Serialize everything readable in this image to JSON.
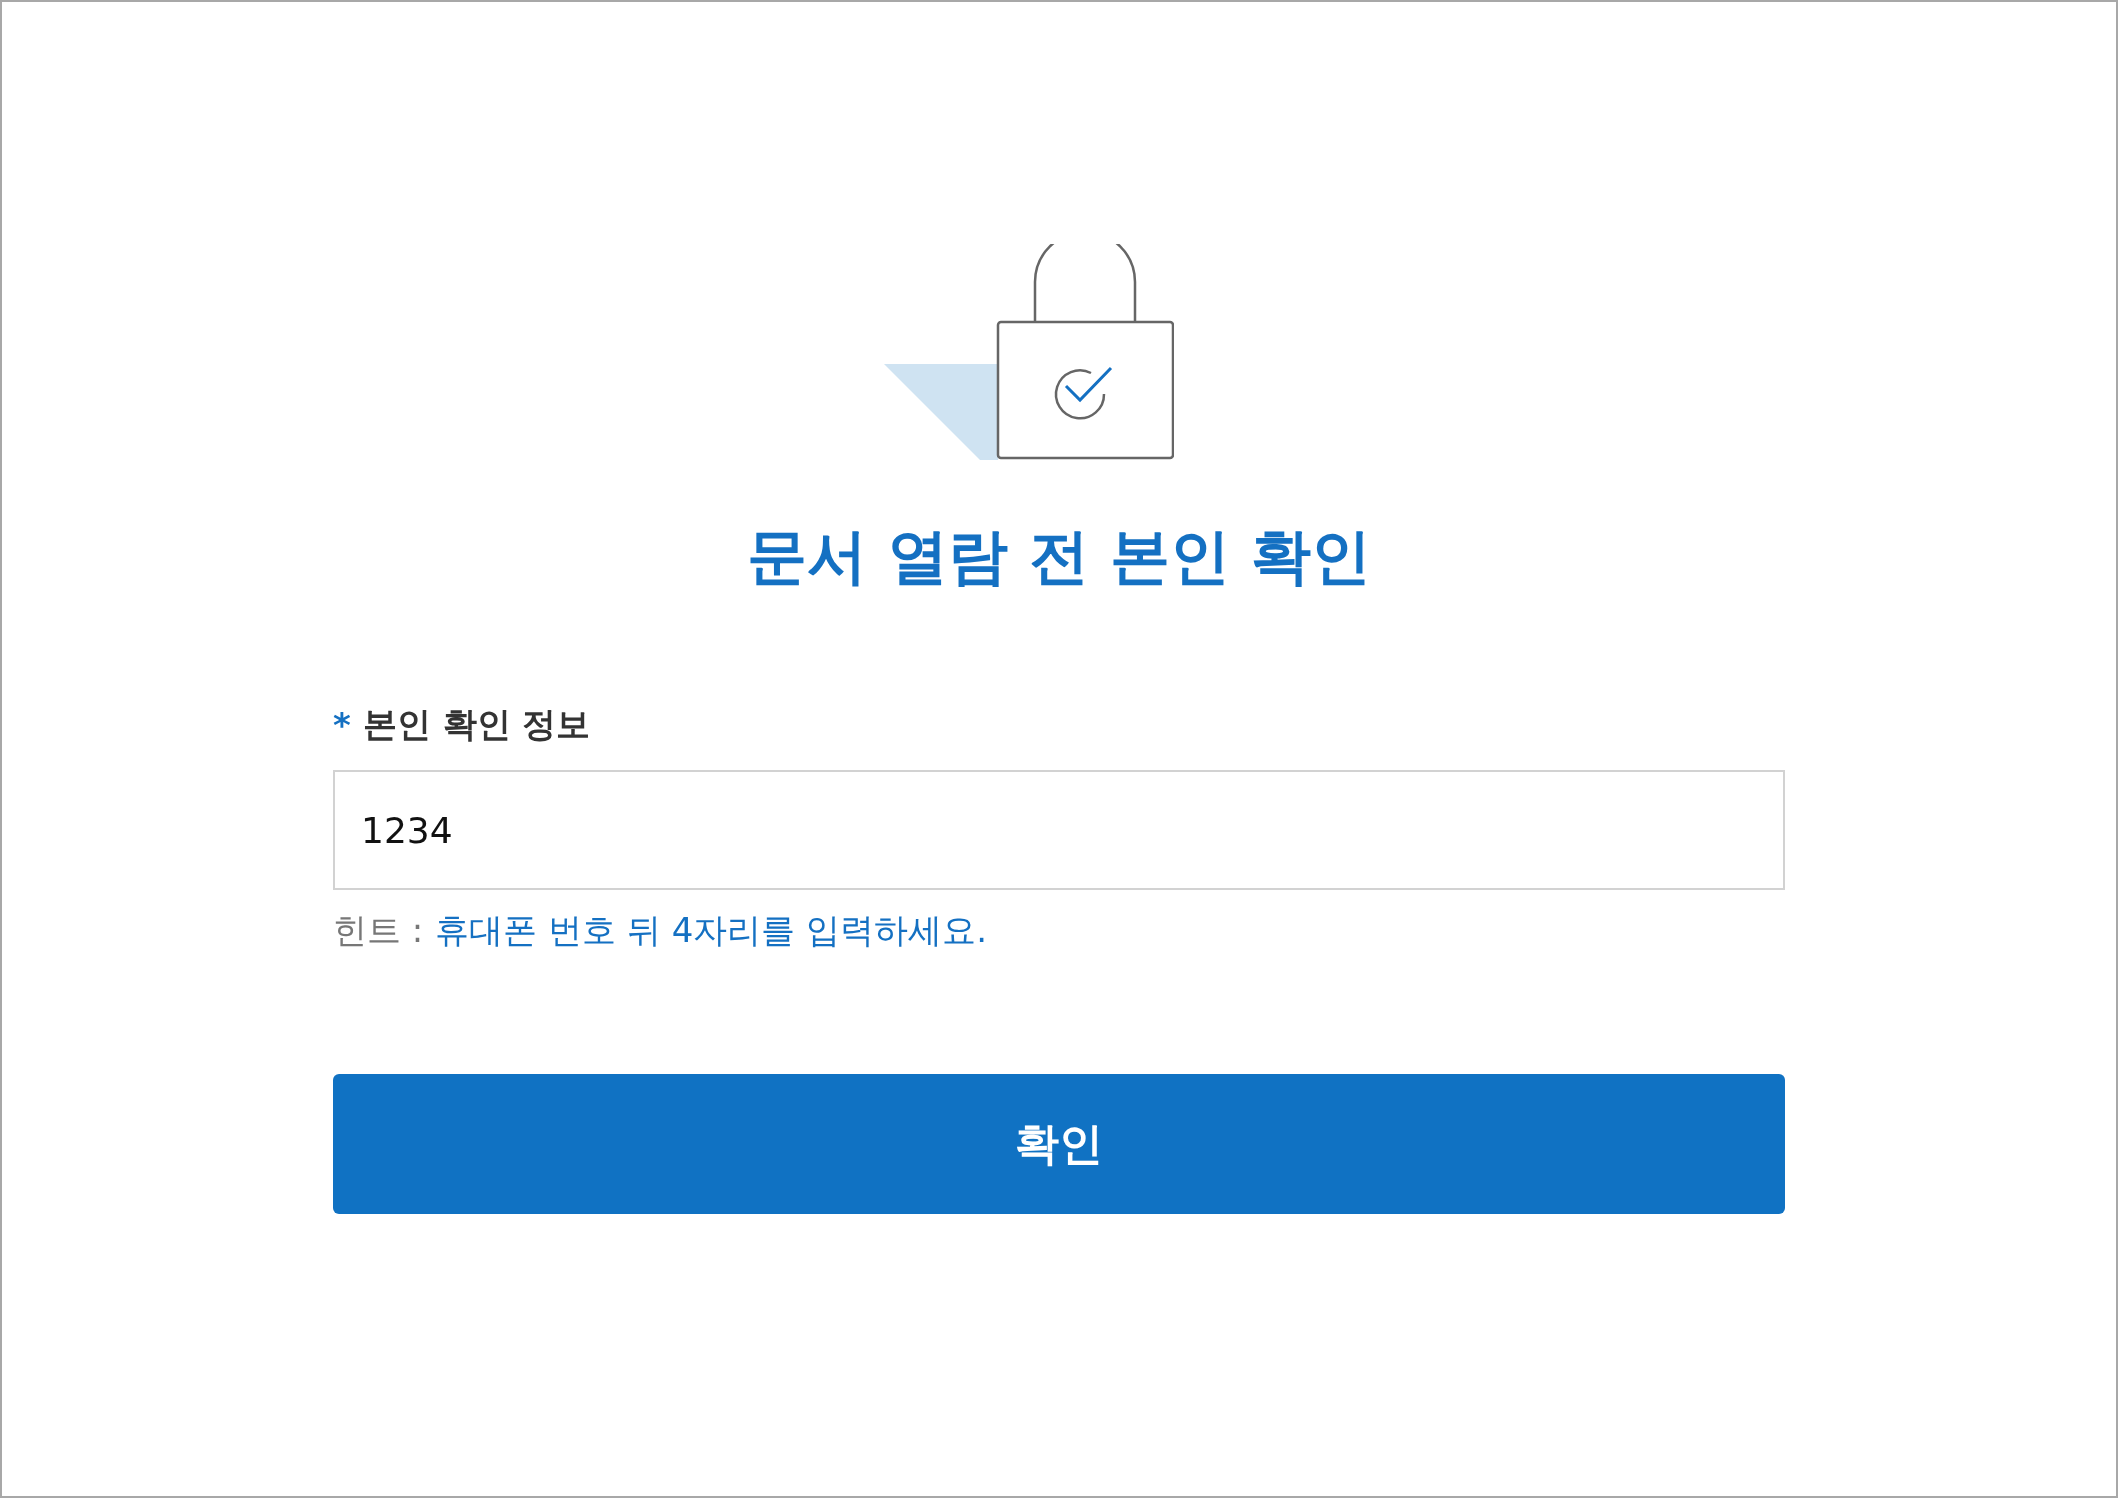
{
  "title": "문서 열람 전 본인 확인",
  "field": {
    "required_mark": "*",
    "label": "본인 확인 정보",
    "value": "1234"
  },
  "hint": {
    "label": "힌트 :",
    "text": "휴대폰 번호 뒤 4자리를 입력하세요."
  },
  "button": {
    "label": "확인"
  }
}
